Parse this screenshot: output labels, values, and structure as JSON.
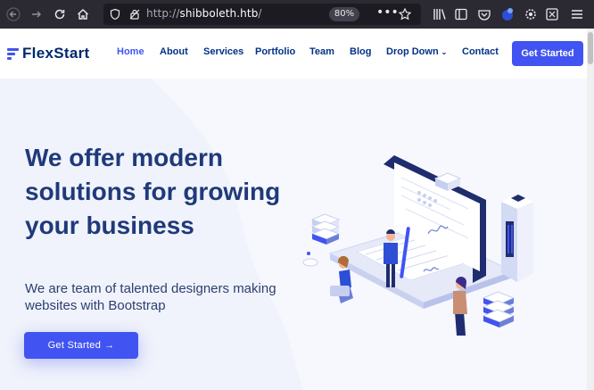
{
  "browser": {
    "url_scheme": "http://",
    "url_host": "shibboleth.htb",
    "url_path": "/",
    "zoom": "80%",
    "more_label": "•••"
  },
  "site": {
    "logo": "FlexStart",
    "nav": [
      "Home",
      "About",
      "Services",
      "Portfolio",
      "Team",
      "Blog",
      "Drop Down",
      "Contact"
    ],
    "cta": "Get Started"
  },
  "hero": {
    "title": "We offer modern solutions for growing your business",
    "subtitle": "We are team of talented designers making websites with Bootstrap",
    "button": "Get Started",
    "button_arrow": "→"
  },
  "colors": {
    "brand": "#4154f1",
    "heading": "#012970"
  }
}
